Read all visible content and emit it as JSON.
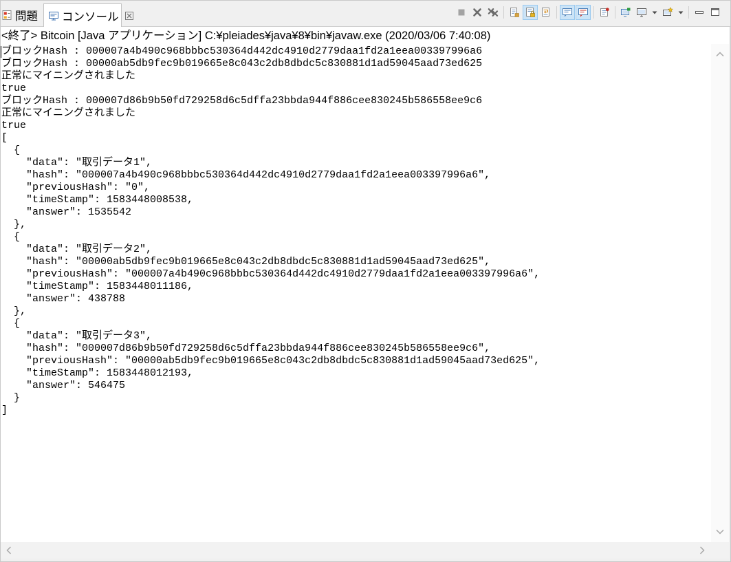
{
  "tabs": [
    {
      "label": "問題",
      "icon": "problems-icon",
      "active": false
    },
    {
      "label": "コンソール",
      "icon": "console-icon",
      "active": true,
      "close_icon": "close-icon"
    }
  ],
  "toolbar": {
    "items": [
      {
        "name": "terminate",
        "icon": "terminate-icon",
        "enabled": false
      },
      {
        "name": "remove-launch",
        "icon": "remove-launch-icon"
      },
      {
        "name": "remove-all-terminated",
        "icon": "remove-all-icon"
      },
      {
        "separator": true
      },
      {
        "name": "clear-console",
        "icon": "clear-console-icon"
      },
      {
        "name": "scroll-lock",
        "icon": "scroll-lock-icon",
        "pressed": true
      },
      {
        "name": "word-wrap",
        "icon": "word-wrap-icon"
      },
      {
        "separator": true
      },
      {
        "name": "show-on-stdout",
        "icon": "show-stdout-icon",
        "pressed": true
      },
      {
        "name": "show-on-stderr",
        "icon": "show-stderr-icon",
        "pressed": true
      },
      {
        "separator": true
      },
      {
        "name": "pin-console",
        "icon": "pin-console-icon"
      },
      {
        "separator": true
      },
      {
        "name": "new-console-view",
        "icon": "new-console-view-icon"
      },
      {
        "name": "display-selected-console",
        "icon": "display-selected-console-icon"
      },
      {
        "name": "display-selected-console-dropdown",
        "icon": "chevron-down-icon",
        "dropdown": true
      },
      {
        "name": "open-console",
        "icon": "open-console-icon"
      },
      {
        "name": "open-console-dropdown",
        "icon": "chevron-down-icon",
        "dropdown": true
      },
      {
        "separator": true
      },
      {
        "name": "minimize",
        "icon": "minimize-icon"
      },
      {
        "name": "maximize",
        "icon": "maximize-icon"
      }
    ]
  },
  "launch": {
    "label": "<終了> Bitcoin [Java アプリケーション] C:¥pleiades¥java¥8¥bin¥javaw.exe (2020/03/06 7:40:08)"
  },
  "console": {
    "lines": [
      "ブロックHash : 000007a4b490c968bbbc530364d442dc4910d2779daa1fd2a1eea003397996a6",
      "ブロックHash : 00000ab5db9fec9b019665e8c043c2db8dbdc5c830881d1ad59045aad73ed625",
      "正常にマイニングされました",
      "true",
      "ブロックHash : 000007d86b9b50fd729258d6c5dffa23bbda944f886cee830245b586558ee9c6",
      "正常にマイニングされました",
      "true",
      "[",
      "  {",
      "    \"data\": \"取引データ1\",",
      "    \"hash\": \"000007a4b490c968bbbc530364d442dc4910d2779daa1fd2a1eea003397996a6\",",
      "    \"previousHash\": \"0\",",
      "    \"timeStamp\": 1583448008538,",
      "    \"answer\": 1535542",
      "  },",
      "  {",
      "    \"data\": \"取引データ2\",",
      "    \"hash\": \"00000ab5db9fec9b019665e8c043c2db8dbdc5c830881d1ad59045aad73ed625\",",
      "    \"previousHash\": \"000007a4b490c968bbbc530364d442dc4910d2779daa1fd2a1eea003397996a6\",",
      "    \"timeStamp\": 1583448011186,",
      "    \"answer\": 438788",
      "  },",
      "  {",
      "    \"data\": \"取引データ3\",",
      "    \"hash\": \"000007d86b9b50fd729258d6c5dffa23bbda944f886cee830245b586558ee9c6\",",
      "    \"previousHash\": \"00000ab5db9fec9b019665e8c043c2db8dbdc5c830881d1ad59045aad73ed625\",",
      "    \"timeStamp\": 1583448012193,",
      "    \"answer\": 546475",
      "  }",
      "]"
    ]
  },
  "scrollbars": {
    "vertical": {
      "up_icon": "chevron-up-icon",
      "down_icon": "chevron-down-icon"
    },
    "horizontal": {
      "left_icon": "chevron-left-icon",
      "right_icon": "chevron-right-icon"
    }
  },
  "colors": {
    "tabbar_bg": "#f0f0f0",
    "active_tab_bg": "#ffffff",
    "console_bg": "#ffffff",
    "console_text": "#000000",
    "pressed_bg": "#cce4f7",
    "pressed_border": "#99c9ef",
    "scroll_track": "#f2f2f2"
  }
}
